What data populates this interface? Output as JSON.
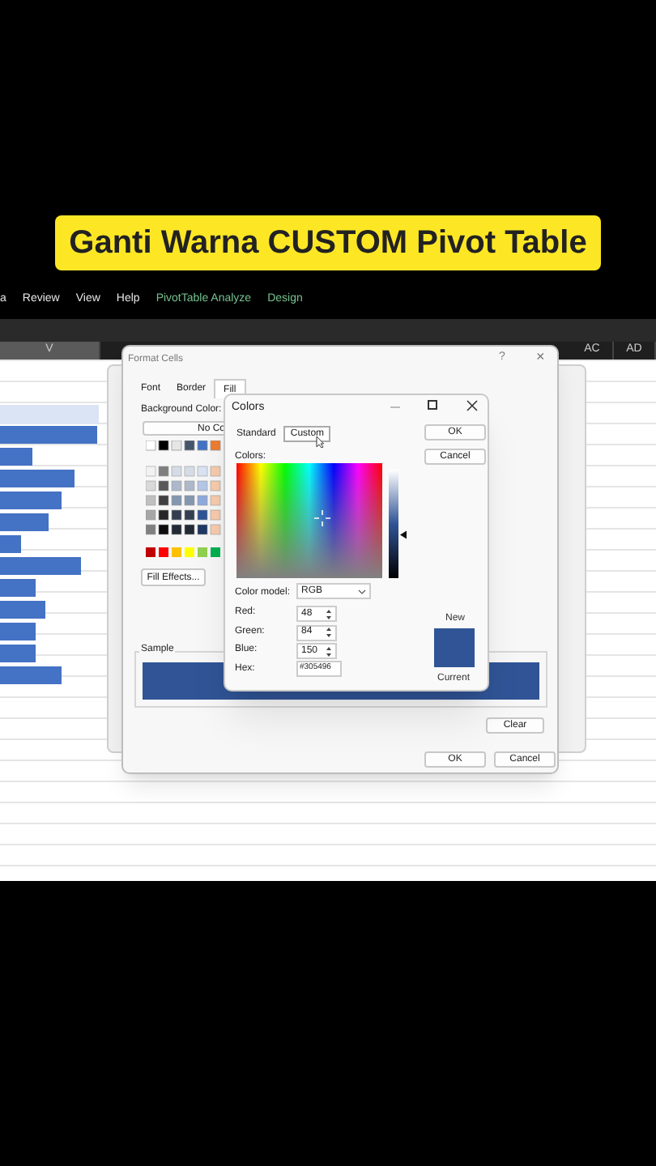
{
  "banner": {
    "title": "Ganti Warna CUSTOM Pivot Table"
  },
  "ribbon": {
    "tabs": [
      {
        "label": "a",
        "kind": "normal"
      },
      {
        "label": "Review",
        "kind": "normal"
      },
      {
        "label": "View",
        "kind": "normal"
      },
      {
        "label": "Help",
        "kind": "normal"
      },
      {
        "label": "PivotTable Analyze",
        "kind": "contextual"
      },
      {
        "label": "Design",
        "kind": "contextual"
      }
    ]
  },
  "sheet": {
    "columns": [
      {
        "label": "V",
        "selected": true
      },
      {
        "label": "AC",
        "selected": false
      },
      {
        "label": "AD",
        "selected": false
      }
    ]
  },
  "format_cells": {
    "title": "Format Cells",
    "help": "?",
    "close": "×",
    "tabs": [
      {
        "label": "Font",
        "selected": false
      },
      {
        "label": "Border",
        "selected": false
      },
      {
        "label": "Fill",
        "selected": true
      }
    ],
    "background_color_label": "Background Color:",
    "no_color_button": "No Co",
    "fill_effects_button": "Fill Effects...",
    "sample_label": "Sample",
    "clear_button": "Clear",
    "buttons": [
      "OK",
      "Cancel"
    ]
  },
  "colors": {
    "title": "Colors",
    "tabs": [
      {
        "label": "Standard",
        "selected": false
      },
      {
        "label": "Custom",
        "selected": true
      }
    ],
    "buttons": [
      "OK",
      "Cancel"
    ],
    "colors_label": "Colors:",
    "color_model_label": "Color model:",
    "color_model": "RGB",
    "fields": [
      {
        "label": "Red:",
        "value": "48"
      },
      {
        "label": "Green:",
        "value": "84"
      },
      {
        "label": "Blue:",
        "value": "150"
      }
    ],
    "luminance": {
      "level": 0.4
    },
    "hex_label": "Hex:",
    "hex": "#305496",
    "new_label": "New",
    "current_label": "Current"
  }
}
